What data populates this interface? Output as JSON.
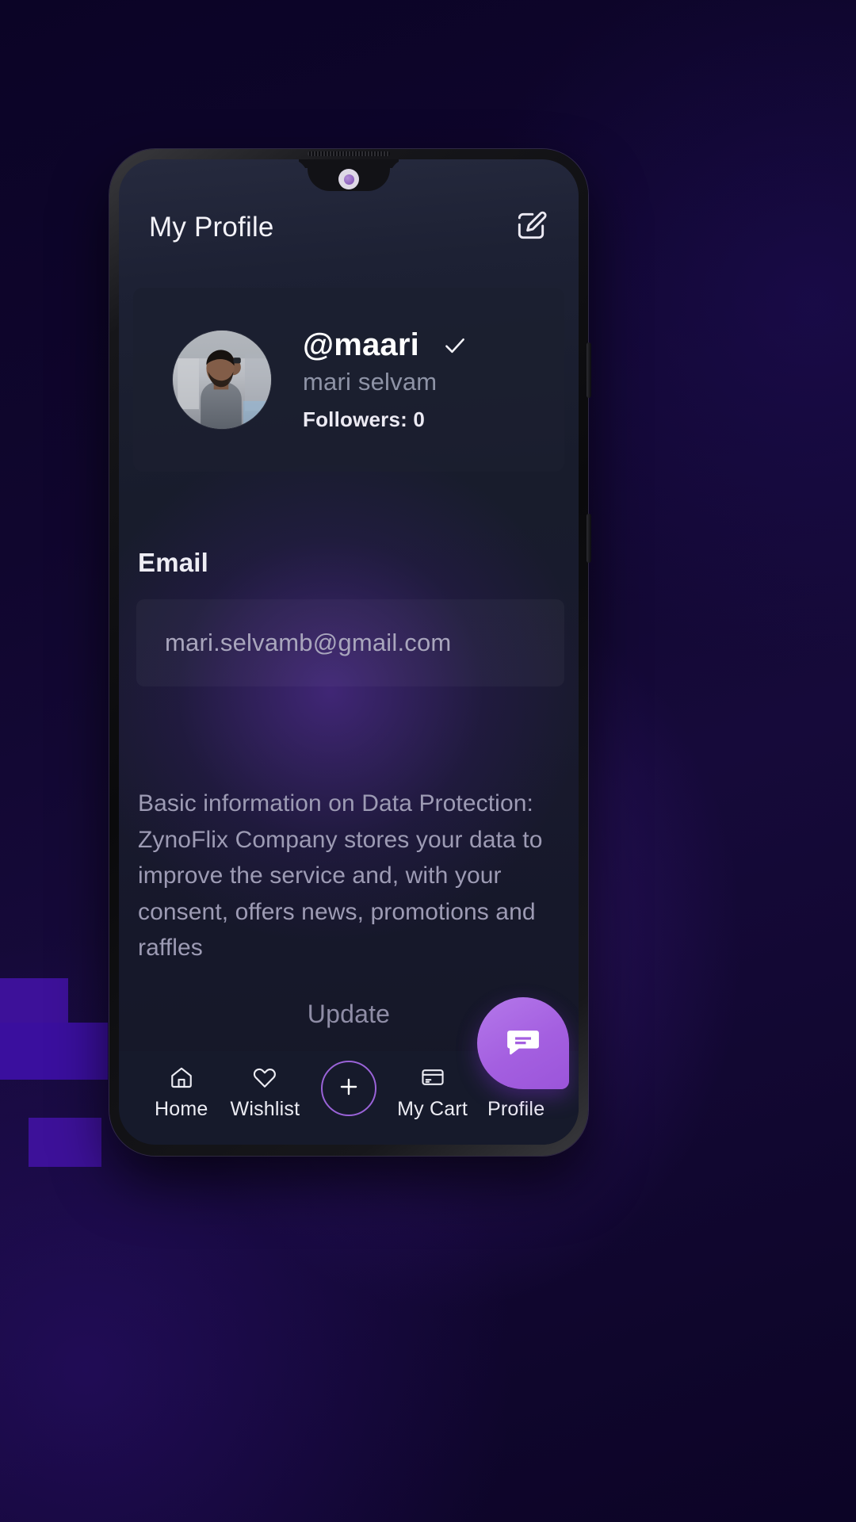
{
  "app": {
    "header": {
      "title": "My Profile",
      "edit_icon": "edit-pencil-icon"
    },
    "profile": {
      "handle": "@maari",
      "verified_icon": "check-verified-icon",
      "full_name": "mari selvam",
      "followers": "Followers: 0",
      "avatar_icon": "user-photo-avatar"
    },
    "email_section": {
      "label": "Email",
      "value": "mari.selvamb@gmail.com",
      "placeholder": "mari.selvamb@gmail.com"
    },
    "privacy": {
      "text": "Basic information on Data Protection: ZynoFlix Company stores your data to improve the service and, with your consent, offers news, promotions and raffles"
    },
    "actions": {
      "update_label": "Update"
    },
    "bottom_nav": {
      "items": [
        {
          "label": "Home",
          "icon": "home-icon"
        },
        {
          "label": "Wishlist",
          "icon": "heart-icon"
        },
        {
          "label": "",
          "icon": "plus-icon"
        },
        {
          "label": "My Cart",
          "icon": "credit-card-icon"
        },
        {
          "label": "Profile",
          "icon": "person-icon"
        }
      ]
    },
    "fab": {
      "icon": "chat-bubble-icon"
    },
    "colors": {
      "accent_purple": "#a45fe0",
      "nav_bar": "#161a2b",
      "card": "#1b1f30",
      "screen_bg": "#181c2c",
      "muted_text": "#9d9bb4"
    }
  }
}
